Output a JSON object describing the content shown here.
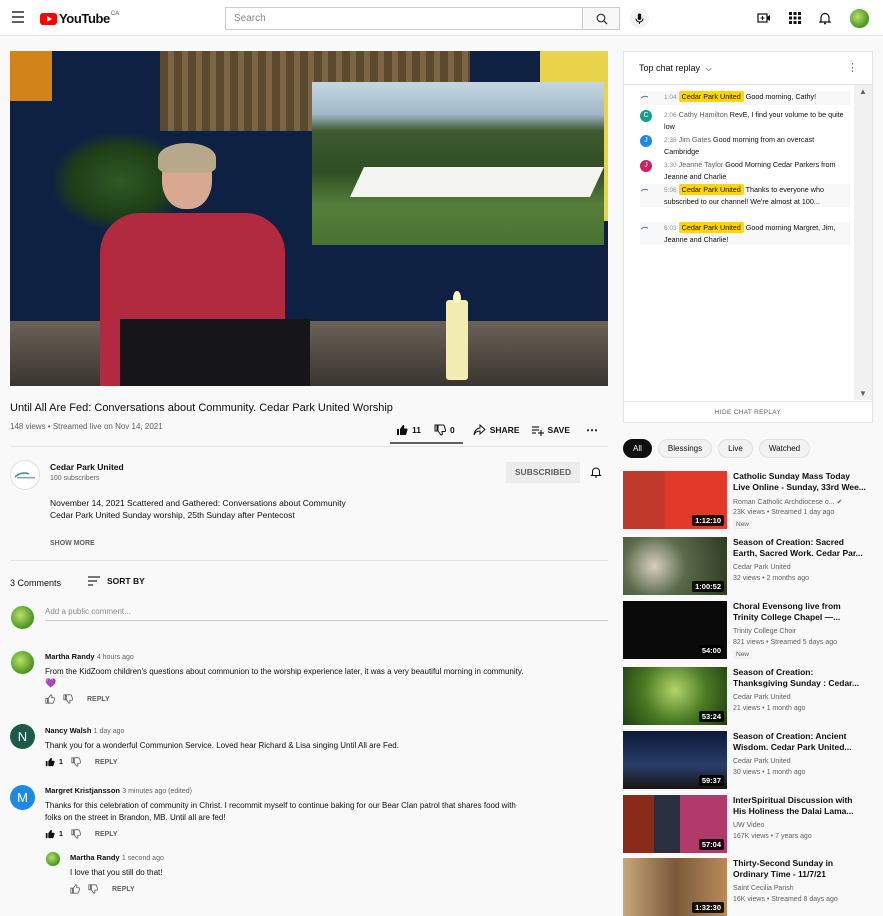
{
  "header": {
    "logo": "YouTube",
    "logo_region": "CA",
    "search_placeholder": "Search"
  },
  "video": {
    "title": "Until All Are Fed: Conversations about Community. Cedar Park United Worship",
    "meta": "148 views • Streamed live on Nov 14, 2021",
    "likes": "11",
    "dislikes": "0",
    "share_label": "SHARE",
    "save_label": "SAVE"
  },
  "channel": {
    "name": "Cedar Park United",
    "subscribers": "100 subscribers",
    "subscribe_label": "SUBSCRIBED",
    "description_line1": "November 14, 2021  Scattered and Gathered: Conversations about Community",
    "description_line2": "Cedar Park United Sunday worship,  25th Sunday after Pentecost",
    "show_more": "SHOW MORE"
  },
  "comments": {
    "count": "3 Comments",
    "sort_label": "SORT BY",
    "add_placeholder": "Add a public comment...",
    "reply_label": "REPLY",
    "items": [
      {
        "author": "Martha Randy",
        "time": "4 hours ago",
        "text": "From the KidZoom children's questions about communion to the worship experience later, it was a very beautiful morning in community.",
        "emoji": "💜",
        "likes": ""
      },
      {
        "author": "Nancy Walsh",
        "time": "1 day ago",
        "initial": "N",
        "color": "#1c5a4a",
        "text": "Thank you for a wonderful Communion Service.  Loved hear Richard & Lisa singing Until All are Fed.",
        "likes": "1"
      },
      {
        "author": "Margret Kristjansson",
        "time": "3 minutes ago (edited)",
        "initial": "M",
        "color": "#1e88e5",
        "text1": "Thanks for this celebration of community in Christ.  I recommit myself to continue baking for our Bear Clan patrol that shares food with",
        "text2": "folks on the street in Brandon, MB.  Until all are fed!",
        "likes": "1"
      },
      {
        "author": "Martha Randy",
        "time": "1 second ago",
        "text": "I love that you still do that!",
        "likes": ""
      }
    ]
  },
  "chat": {
    "header": "Top chat replay",
    "hide_label": "HIDE CHAT REPLAY",
    "messages": [
      {
        "time": "1:04",
        "author": "Cedar Park United",
        "owner": true,
        "text": "Good morning, Cathy!"
      },
      {
        "time": "2:06",
        "author": "Cathy Hamilton",
        "initial": "C",
        "color": "#129e8b",
        "text": "RevE, I find your volume to be quite low"
      },
      {
        "time": "2:38",
        "author": "Jim Gates",
        "initial": "J",
        "color": "#1e88e5",
        "text": "Good morning from an overcast Cambridge"
      },
      {
        "time": "3:30",
        "author": "Jeanne Taylor",
        "initial": "J",
        "color": "#d81b60",
        "text": "Good Morning Cedar Parkers from Jeanne and Charlie"
      },
      {
        "time": "5:06",
        "author": "Cedar Park United",
        "owner": true,
        "text": "Thanks to everyone who subscribed to our channel! We're almost at 100..."
      },
      {
        "time": "6:03",
        "author": "Cedar Park United",
        "owner": true,
        "text": "Good morning Margret, Jim, Jeanne and Charlie!"
      }
    ]
  },
  "chips": [
    "All",
    "Blessings",
    "Live",
    "Watched"
  ],
  "recommendations": [
    {
      "title1": "Catholic Sunday Mass Today",
      "title2": "Live Online - Sunday, 33rd Wee...",
      "channel": "Roman Catholic Archdiocese o...",
      "meta": "23K views • Streamed 1 day ago",
      "badge": "New",
      "duration": "1:12:10"
    },
    {
      "title1": "Season of Creation: Sacred",
      "title2": "Earth, Sacred Work. Cedar Par...",
      "channel": "Cedar Park United",
      "meta": "32 views • 2 months ago",
      "duration": "1:00:52"
    },
    {
      "title1": "Choral Evensong live from",
      "title2": "Trinity College Chapel —...",
      "channel": "Trinity College Choir",
      "meta": "821 views • Streamed 5 days ago",
      "badge": "New",
      "duration": "54:00"
    },
    {
      "title1": "Season of Creation:",
      "title2": "Thanksgiving Sunday : Cedar...",
      "channel": "Cedar Park United",
      "meta": "21 views • 1 month ago",
      "duration": "53:24"
    },
    {
      "title1": "Season of Creation: Ancient",
      "title2": "Wisdom. Cedar Park United...",
      "channel": "Cedar Park United",
      "meta": "30 views • 1 month ago",
      "duration": "59:37"
    },
    {
      "title1": "InterSpiritual Discussion with",
      "title2": "His Holiness the Dalai Lama...",
      "channel": "UW Video",
      "meta": "167K views • 7 years ago",
      "duration": "57:04"
    },
    {
      "title1": "Thirty-Second Sunday in",
      "title2": "Ordinary Time - 11/7/21",
      "channel": "Saint Cecilia Parish",
      "meta": "16K views • Streamed 8 days ago",
      "duration": "1:32:30"
    }
  ],
  "colors": {
    "brand": "#ff0000",
    "owner_badge": "#ffd600",
    "verified": "#606060"
  }
}
